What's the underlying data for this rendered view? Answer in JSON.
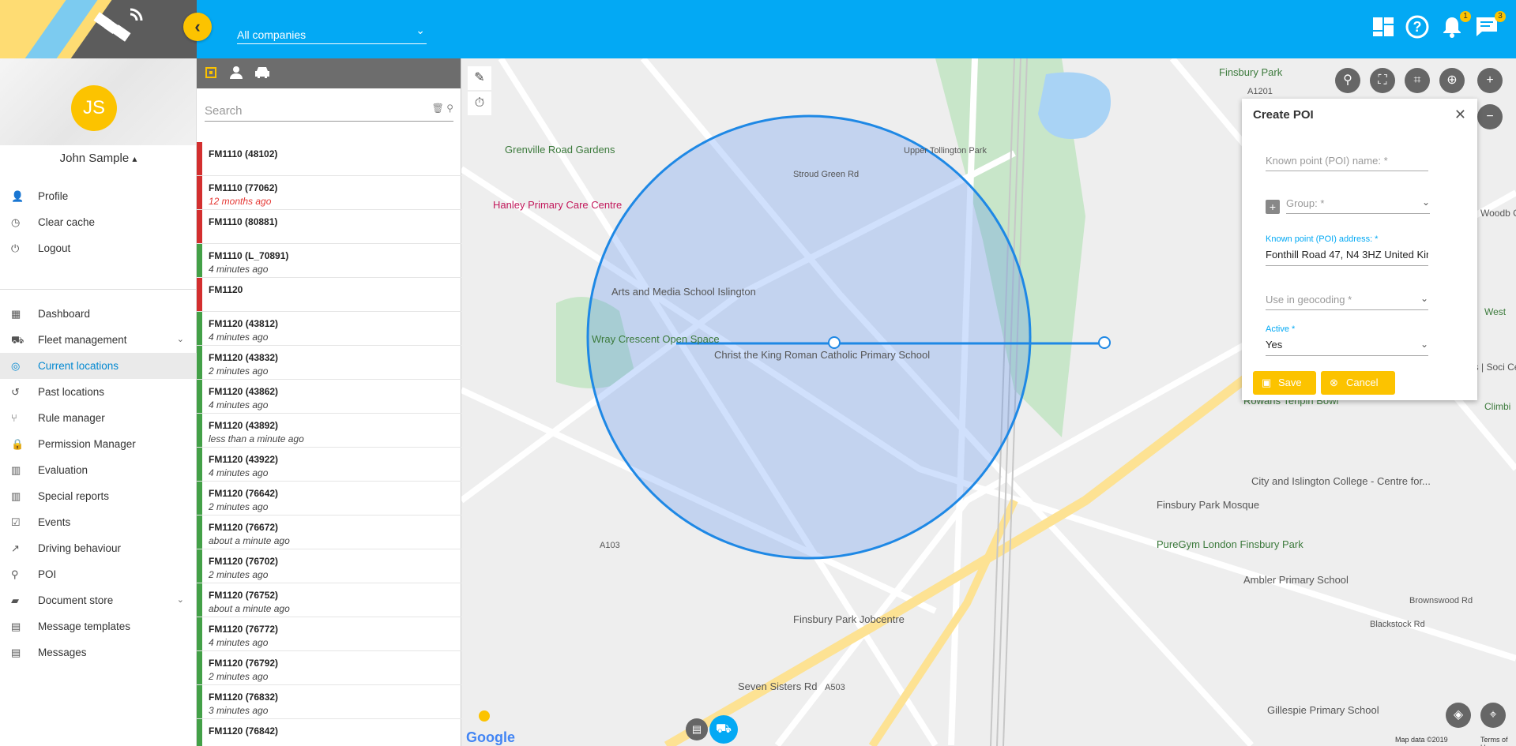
{
  "header": {
    "company_select": "All companies",
    "notifications_count": "1",
    "messages_count": "3"
  },
  "user": {
    "initials": "JS",
    "name": "John Sample"
  },
  "user_menu": [
    {
      "label": "Profile",
      "icon": "person-icon"
    },
    {
      "label": "Clear cache",
      "icon": "clock-icon"
    },
    {
      "label": "Logout",
      "icon": "power-icon"
    }
  ],
  "nav": [
    {
      "label": "Dashboard",
      "icon": "dashboard-icon"
    },
    {
      "label": "Fleet management",
      "icon": "car-icon",
      "expandable": true
    },
    {
      "label": "Current locations",
      "icon": "location-target-icon",
      "active": true
    },
    {
      "label": "Past locations",
      "icon": "history-icon"
    },
    {
      "label": "Rule manager",
      "icon": "hierarchy-icon"
    },
    {
      "label": "Permission Manager",
      "icon": "lock-icon"
    },
    {
      "label": "Evaluation",
      "icon": "bar-chart-icon"
    },
    {
      "label": "Special reports",
      "icon": "bar-chart-icon"
    },
    {
      "label": "Events",
      "icon": "calendar-check-icon"
    },
    {
      "label": "Driving behaviour",
      "icon": "trending-icon"
    },
    {
      "label": "POI",
      "icon": "map-pin-icon"
    },
    {
      "label": "Document store",
      "icon": "folder-icon",
      "expandable": true
    },
    {
      "label": "Message templates",
      "icon": "message-icon"
    },
    {
      "label": "Messages",
      "icon": "message-icon"
    }
  ],
  "vehicle_panel": {
    "search_placeholder": "Search",
    "vehicles": [
      {
        "name": "FM1110 (48102)",
        "time": "",
        "status": "red"
      },
      {
        "name": "FM1110 (77062)",
        "time": "12 months ago",
        "status": "red",
        "old": true
      },
      {
        "name": "FM1110 (80881)",
        "time": "",
        "status": "red"
      },
      {
        "name": "FM1110 (L_70891)",
        "time": "4 minutes ago",
        "status": "green"
      },
      {
        "name": "FM1120",
        "time": "",
        "status": "red"
      },
      {
        "name": "FM1120 (43812)",
        "time": "4 minutes ago",
        "status": "green"
      },
      {
        "name": "FM1120 (43832)",
        "time": "2 minutes ago",
        "status": "green"
      },
      {
        "name": "FM1120 (43862)",
        "time": "4 minutes ago",
        "status": "green"
      },
      {
        "name": "FM1120 (43892)",
        "time": "less than a minute ago",
        "status": "green"
      },
      {
        "name": "FM1120 (43922)",
        "time": "4 minutes ago",
        "status": "green"
      },
      {
        "name": "FM1120 (76642)",
        "time": "2 minutes ago",
        "status": "green"
      },
      {
        "name": "FM1120 (76672)",
        "time": "about a minute ago",
        "status": "green"
      },
      {
        "name": "FM1120 (76702)",
        "time": "2 minutes ago",
        "status": "green"
      },
      {
        "name": "FM1120 (76752)",
        "time": "about a minute ago",
        "status": "green"
      },
      {
        "name": "FM1120 (76772)",
        "time": "4 minutes ago",
        "status": "green"
      },
      {
        "name": "FM1120 (76792)",
        "time": "2 minutes ago",
        "status": "green"
      },
      {
        "name": "FM1120 (76832)",
        "time": "3 minutes ago",
        "status": "green"
      },
      {
        "name": "FM1120 (76842)",
        "time": "",
        "status": "green"
      }
    ]
  },
  "map": {
    "labels": [
      "Finsbury Park",
      "Grenville Road Gardens",
      "Hanley Primary Care Centre",
      "Arts and Media School Islington",
      "Wray Crescent Open Space",
      "Christ the King Roman Catholic Primary School",
      "Rowans Tenpin Bowl",
      "Finsbury Park Mosque",
      "City and Islington College - Centre for...",
      "PureGym London Finsbury Park",
      "Ambler Primary School",
      "Finsbury Park Jobcentre",
      "Gillespie Primary School",
      "Seven Sisters Rd",
      "Stroud Green Rd",
      "Upper Tollington Park",
      "Blackstock Rd",
      "Brownswood Rd",
      "A1201",
      "A103",
      "A503",
      "Woodb Childre",
      "West",
      "es | Soci Centre",
      "Climbi"
    ],
    "footer_google": "Google",
    "map_data": "Map data ©2019",
    "terms": "Terms of Use"
  },
  "poi_dialog": {
    "title": "Create POI",
    "name_placeholder": "Known point (POI) name: *",
    "group_placeholder": "Group: *",
    "address_label": "Known point (POI) address: *",
    "address_value": "Fonthill Road 47, N4 3HZ United Kingdom",
    "geocoding_placeholder": "Use in geocoding *",
    "active_label": "Active *",
    "active_value": "Yes",
    "save_label": "Save",
    "cancel_label": "Cancel"
  },
  "colors": {
    "topbar": "#03a9f4",
    "accent": "#fcc300",
    "circle": "#1e88e5",
    "status_red": "#d32f2f",
    "status_green": "#43a047"
  }
}
